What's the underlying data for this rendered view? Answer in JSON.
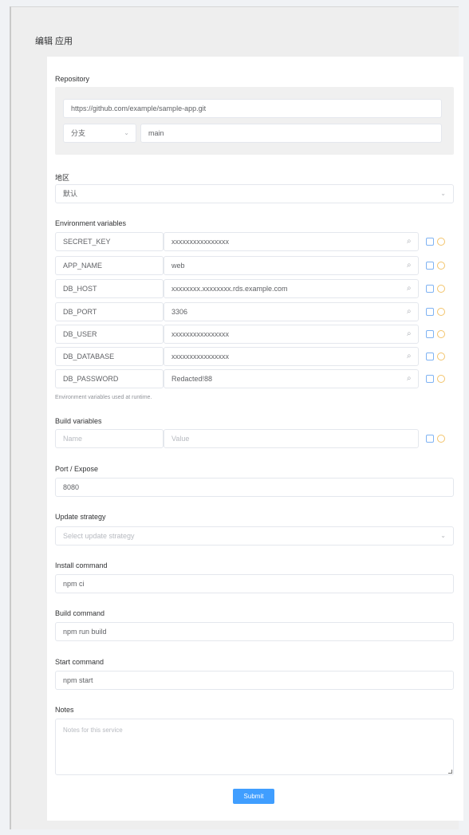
{
  "page": {
    "title": "编辑 应用"
  },
  "repo": {
    "label": "Repository",
    "url": "https://github.com/example/sample-app.git",
    "branch_type": "分支",
    "branch": "main"
  },
  "region": {
    "label": "地区",
    "value": "默认"
  },
  "env": {
    "label": "Environment variables",
    "rows": [
      {
        "key": "SECRET_KEY",
        "value": "xxxxxxxxxxxxxxxx"
      },
      {
        "key": "APP_NAME",
        "value": "web"
      },
      {
        "key": "DB_HOST",
        "value": "xxxxxxxx.xxxxxxxx.rds.example.com"
      },
      {
        "key": "DB_PORT",
        "value": "3306"
      },
      {
        "key": "DB_USER",
        "value": "xxxxxxxxxxxxxxxx"
      },
      {
        "key": "DB_DATABASE",
        "value": "xxxxxxxxxxxxxxxx"
      },
      {
        "key": "DB_PASSWORD",
        "value": "Redacted!88"
      }
    ],
    "hint": "Environment variables used at runtime."
  },
  "build_vars": {
    "label": "Build variables",
    "key_placeholder": "Name",
    "value_placeholder": "Value"
  },
  "port": {
    "label": "Port / Expose",
    "value": "8080"
  },
  "update_strategy": {
    "label": "Update strategy",
    "placeholder": "Select update strategy"
  },
  "install": {
    "label": "Install command",
    "value": "npm ci"
  },
  "build": {
    "label": "Build command",
    "value": "npm run build"
  },
  "start": {
    "label": "Start command",
    "value": "npm start"
  },
  "notes": {
    "label": "Notes",
    "placeholder": "Notes for this service"
  },
  "submit": {
    "label": "Submit"
  },
  "icons": [
    "search-icon",
    "add-icon",
    "remove-icon",
    "chevron-down-icon"
  ],
  "colors": {
    "primary": "#409eff",
    "add": "#7fb3f3",
    "remove": "#f3c46b"
  }
}
